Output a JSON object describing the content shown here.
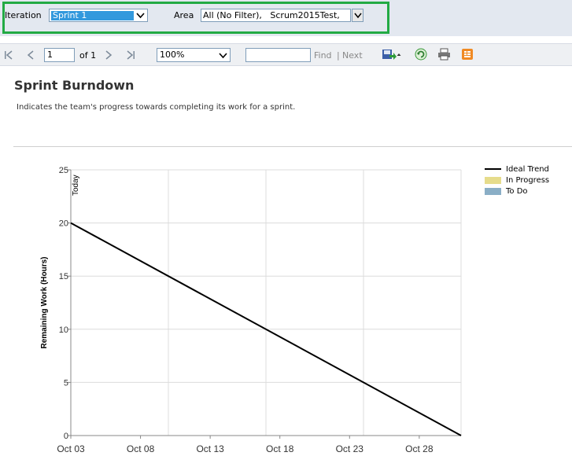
{
  "parameters": {
    "iteration_label": "Iteration",
    "iteration_value": "Sprint 1",
    "area_label": "Area",
    "area_value": "All (No Filter),   Scrum2015Test,"
  },
  "toolbar": {
    "page_number": "1",
    "page_of": "of 1",
    "zoom": "100%",
    "find_label": "Find",
    "separator": "|",
    "next_label": "Next"
  },
  "report": {
    "title": "Sprint Burndown",
    "description": "Indicates the team's progress towards completing its work for a sprint."
  },
  "colors": {
    "highlight": "#22aa44",
    "ideal_trend": "#000000",
    "in_progress": "#e6dc8c",
    "to_do": "#8aaec6"
  },
  "chart_data": {
    "type": "line",
    "xlabel": "",
    "ylabel": "Remaining Work (Hours)",
    "x_ticks": [
      "Oct 03",
      "Oct 08",
      "Oct 13",
      "Oct 18",
      "Oct 23",
      "Oct 28"
    ],
    "y_ticks": [
      "0",
      "5",
      "10",
      "15",
      "20",
      "25"
    ],
    "ylim": [
      0,
      25
    ],
    "xlim": [
      "2015-10-03",
      "2015-10-31"
    ],
    "grid": true,
    "legend_position": "top-right",
    "today_marker": {
      "label": "Today",
      "x": "2015-10-03"
    },
    "series": [
      {
        "name": "Ideal Trend",
        "points": [
          [
            "2015-10-03",
            20
          ],
          [
            "2015-10-31",
            0
          ]
        ]
      },
      {
        "name": "In Progress",
        "points": []
      },
      {
        "name": "To Do",
        "points": []
      }
    ]
  }
}
